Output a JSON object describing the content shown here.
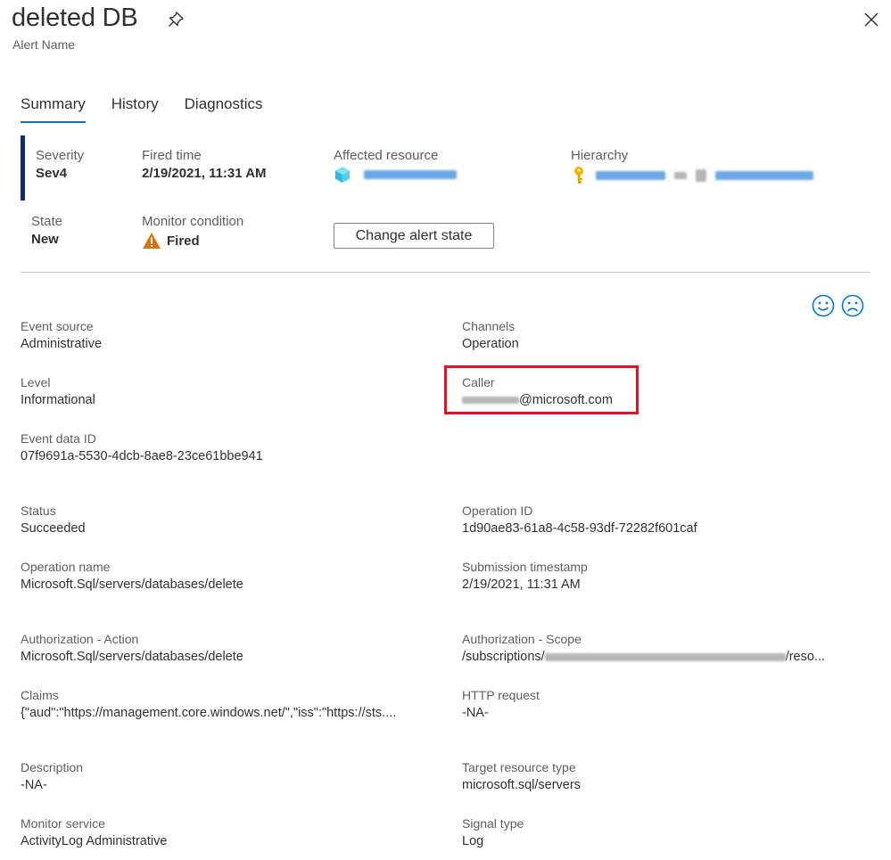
{
  "header": {
    "title": "deleted DB",
    "subtitle": "Alert Name"
  },
  "tabs": [
    {
      "label": "Summary",
      "active": true
    },
    {
      "label": "History",
      "active": false
    },
    {
      "label": "Diagnostics",
      "active": false
    }
  ],
  "summary": {
    "severity": {
      "label": "Severity",
      "value": "Sev4"
    },
    "fired_time": {
      "label": "Fired time",
      "value": "2/19/2021, 11:31 AM"
    },
    "affected_resource": {
      "label": "Affected resource",
      "icon": "sql-database-icon"
    },
    "hierarchy": {
      "label": "Hierarchy",
      "icon": "key-icon"
    },
    "state": {
      "label": "State",
      "value": "New"
    },
    "monitor_condition": {
      "label": "Monitor condition",
      "value": "Fired",
      "icon": "warning-icon"
    },
    "change_state_button": "Change alert state"
  },
  "feedback": {
    "smile_icon": "smile-icon",
    "frown_icon": "frown-icon"
  },
  "details": {
    "event_source": {
      "label": "Event source",
      "value": "Administrative"
    },
    "channels": {
      "label": "Channels",
      "value": "Operation"
    },
    "level": {
      "label": "Level",
      "value": "Informational"
    },
    "caller": {
      "label": "Caller",
      "value": "@microsoft.com"
    },
    "event_data_id": {
      "label": "Event data ID",
      "value": "07f9691a-5530-4dcb-8ae8-23ce61bbe941"
    },
    "status": {
      "label": "Status",
      "value": "Succeeded"
    },
    "operation_id": {
      "label": "Operation ID",
      "value": "1d90ae83-61a8-4c58-93df-72282f601caf"
    },
    "operation_name": {
      "label": "Operation name",
      "value": "Microsoft.Sql/servers/databases/delete"
    },
    "submission_timestamp": {
      "label": "Submission timestamp",
      "value": "2/19/2021, 11:31 AM"
    },
    "authorization_action": {
      "label": "Authorization - Action",
      "value": "Microsoft.Sql/servers/databases/delete"
    },
    "authorization_scope": {
      "label": "Authorization - Scope",
      "value_prefix": "/subscriptions/",
      "value_suffix": "/reso..."
    },
    "claims": {
      "label": "Claims",
      "value": "{\"aud\":\"https://management.core.windows.net/\",\"iss\":\"https://sts...."
    },
    "http_request": {
      "label": "HTTP request",
      "value": "-NA-"
    },
    "description": {
      "label": "Description",
      "value": "-NA-"
    },
    "target_resource_type": {
      "label": "Target resource type",
      "value": "microsoft.sql/servers"
    },
    "monitor_service": {
      "label": "Monitor service",
      "value": "ActivityLog Administrative"
    },
    "signal_type": {
      "label": "Signal type",
      "value": "Log"
    }
  },
  "colors": {
    "accent": "#0078d4",
    "severity_bar": "#0f2a7a",
    "highlight_box": "#e81123",
    "warning": "#d9730d"
  }
}
